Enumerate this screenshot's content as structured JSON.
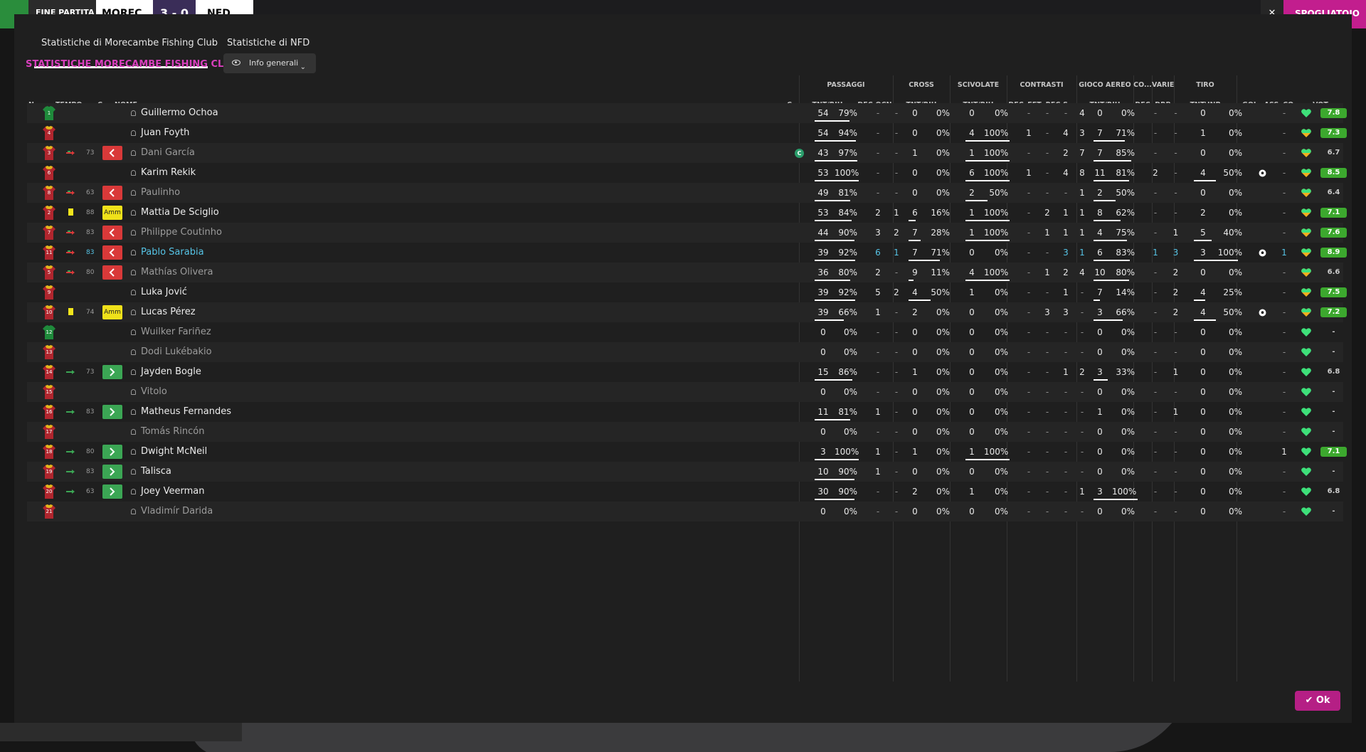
{
  "topbar": {
    "end_match": "FINE PARTITA",
    "home": "MOREC",
    "score": "3 - 0",
    "away": "NFD",
    "close": "✕",
    "subs": "SPOGLIATOIO"
  },
  "tabs": [
    {
      "label": "Statistiche di Morecambe Fishing Club",
      "active": true
    },
    {
      "label": "Statistiche di NFD",
      "active": false
    }
  ],
  "section_title": "STATISTICHE MORECAMBE FISHING CLUB",
  "view_dropdown": {
    "label": "Info generali"
  },
  "groups": {
    "passaggi": "PASSAGGI",
    "cross": "CROSS",
    "scivolate": "SCIVOLATE",
    "contrasti": "CONTRASTI",
    "gioco_aereo": "GIOCO AEREO",
    "co": "CO...",
    "varie": "VARIE",
    "tiro": "TIRO"
  },
  "columns": {
    "n": "N.",
    "tempo": "TEMPO",
    "c": "C",
    "nome": "NOME",
    "c2": "C",
    "pass_tr": "TNT/RIU",
    "dec": "DEC",
    "ocn": "OCN",
    "cross_tr": "TNT/RIU",
    "sciv_tr": "TNT/RIU",
    "c_dec": "DEC",
    "fft": "FFT",
    "rec": "REC",
    "s": "S...",
    "air_tr": "TNT/RIU",
    "co_dec": "DEC",
    "drb": "DRB",
    "tiro_tr": "TNT\\INP",
    "gol": "GOL",
    "ass": "ASS",
    "cond": "CO...",
    "vot": "VOT"
  },
  "players": [
    {
      "n": "1",
      "name": "Guillermo Ochoa",
      "gk": true,
      "min": "",
      "sub": "",
      "badge": "",
      "card": false,
      "captain": false,
      "dim": false,
      "hl": false,
      "pt": "54",
      "pp": "79%",
      "pf": 0.79,
      "dec": "-",
      "ocn": "-",
      "ct": "0",
      "cp": "0%",
      "cf": 0,
      "st": "0",
      "sp": "0%",
      "sf": 0,
      "kdec": "-",
      "fft": "-",
      "rec": "-",
      "s": "4",
      "at": "0",
      "ap": "0%",
      "af": 0,
      "cdec": "-",
      "drb": "-",
      "tt": "0",
      "tp": "0%",
      "tf": 0,
      "gol": "",
      "ass": "-",
      "heart": "green",
      "rating": "7.8",
      "rc": "#3ca82e"
    },
    {
      "n": "4",
      "name": "Juan Foyth",
      "gk": false,
      "min": "",
      "sub": "",
      "badge": "",
      "card": false,
      "captain": false,
      "dim": false,
      "hl": false,
      "pt": "54",
      "pp": "94%",
      "pf": 0.94,
      "dec": "-",
      "ocn": "-",
      "ct": "0",
      "cp": "0%",
      "cf": 0,
      "st": "4",
      "sp": "100%",
      "sf": 1,
      "kdec": "1",
      "fft": "-",
      "rec": "4",
      "s": "3",
      "at": "7",
      "ap": "71%",
      "af": 0.71,
      "cdec": "-",
      "drb": "-",
      "tt": "1",
      "tp": "0%",
      "tf": 0,
      "gol": "",
      "ass": "-",
      "heart": "half",
      "rating": "7.3",
      "rc": "#3ca82e"
    },
    {
      "n": "3",
      "name": "Dani García",
      "gk": false,
      "min": "73",
      "sub": "out",
      "badge": "out",
      "card": false,
      "captain": true,
      "dim": true,
      "hl": false,
      "pt": "43",
      "pp": "97%",
      "pf": 0.97,
      "dec": "-",
      "ocn": "-",
      "ct": "1",
      "cp": "0%",
      "cf": 0,
      "st": "1",
      "sp": "100%",
      "sf": 1,
      "kdec": "-",
      "fft": "-",
      "rec": "2",
      "s": "7",
      "at": "7",
      "ap": "85%",
      "af": 0.85,
      "cdec": "-",
      "drb": "-",
      "tt": "0",
      "tp": "0%",
      "tf": 0,
      "gol": "",
      "ass": "-",
      "heart": "half",
      "rating": "6.7",
      "rc": ""
    },
    {
      "n": "6",
      "name": "Karim Rekik",
      "gk": false,
      "min": "",
      "sub": "",
      "badge": "",
      "card": false,
      "captain": false,
      "dim": false,
      "hl": false,
      "pt": "53",
      "pp": "100%",
      "pf": 1,
      "dec": "-",
      "ocn": "-",
      "ct": "0",
      "cp": "0%",
      "cf": 0,
      "st": "6",
      "sp": "100%",
      "sf": 1,
      "kdec": "1",
      "fft": "-",
      "rec": "4",
      "s": "8",
      "at": "11",
      "ap": "81%",
      "af": 0.81,
      "cdec": "2",
      "drb": "-",
      "tt": "4",
      "tp": "50%",
      "tf": 0.5,
      "gol": "ball",
      "ass": "-",
      "heart": "half",
      "rating": "8.5",
      "rc": "#3ca82e"
    },
    {
      "n": "8",
      "name": "Paulinho",
      "gk": false,
      "min": "63",
      "sub": "out",
      "badge": "out",
      "card": false,
      "captain": false,
      "dim": true,
      "hl": false,
      "pt": "49",
      "pp": "81%",
      "pf": 0.81,
      "dec": "-",
      "ocn": "-",
      "ct": "0",
      "cp": "0%",
      "cf": 0,
      "st": "2",
      "sp": "50%",
      "sf": 0.5,
      "kdec": "-",
      "fft": "-",
      "rec": "-",
      "s": "1",
      "at": "2",
      "ap": "50%",
      "af": 0.5,
      "cdec": "-",
      "drb": "-",
      "tt": "0",
      "tp": "0%",
      "tf": 0,
      "gol": "",
      "ass": "-",
      "heart": "half",
      "rating": "6.4",
      "rc": ""
    },
    {
      "n": "2",
      "name": "Mattia De Sciglio",
      "gk": false,
      "min": "88",
      "sub": "",
      "badge": "amm",
      "card": true,
      "captain": false,
      "dim": false,
      "hl": false,
      "pt": "53",
      "pp": "84%",
      "pf": 0.84,
      "dec": "2",
      "ocn": "1",
      "ct": "6",
      "cp": "16%",
      "cf": 0.16,
      "st": "1",
      "sp": "100%",
      "sf": 1,
      "kdec": "-",
      "fft": "2",
      "rec": "1",
      "s": "1",
      "at": "8",
      "ap": "62%",
      "af": 0.62,
      "cdec": "-",
      "drb": "-",
      "tt": "2",
      "tp": "0%",
      "tf": 0,
      "gol": "",
      "ass": "-",
      "heart": "half",
      "rating": "7.1",
      "rc": "#3ca82e"
    },
    {
      "n": "7",
      "name": "Philippe Coutinho",
      "gk": false,
      "min": "83",
      "sub": "out",
      "badge": "out",
      "card": false,
      "captain": false,
      "dim": true,
      "hl": false,
      "pt": "44",
      "pp": "90%",
      "pf": 0.9,
      "dec": "3",
      "ocn": "2",
      "ct": "7",
      "cp": "28%",
      "cf": 0.28,
      "st": "1",
      "sp": "100%",
      "sf": 1,
      "kdec": "-",
      "fft": "1",
      "rec": "1",
      "s": "1",
      "at": "4",
      "ap": "75%",
      "af": 0.75,
      "cdec": "-",
      "drb": "1",
      "tt": "5",
      "tp": "40%",
      "tf": 0.4,
      "gol": "",
      "ass": "-",
      "heart": "half",
      "rating": "7.6",
      "rc": "#3ca82e"
    },
    {
      "n": "11",
      "name": "Pablo Sarabia",
      "gk": false,
      "min": "83",
      "sub": "out",
      "badge": "out",
      "card": false,
      "captain": false,
      "dim": false,
      "hl": true,
      "pt": "39",
      "pp": "92%",
      "pf": 0.92,
      "dec": "6",
      "ocn": "1",
      "ct": "7",
      "cp": "71%",
      "cf": 0.71,
      "st": "0",
      "sp": "0%",
      "sf": 0,
      "kdec": "-",
      "fft": "-",
      "rec": "3",
      "s": "1",
      "at": "6",
      "ap": "83%",
      "af": 0.83,
      "cdec": "1",
      "drb": "3",
      "tt": "3",
      "tp": "100%",
      "tf": 1,
      "gol": "ball",
      "ass": "1",
      "heart": "half",
      "rating": "8.9",
      "rc": "#3ca82e"
    },
    {
      "n": "5",
      "name": "Mathías Olivera",
      "gk": false,
      "min": "80",
      "sub": "out",
      "badge": "out",
      "card": false,
      "captain": false,
      "dim": true,
      "hl": false,
      "pt": "36",
      "pp": "80%",
      "pf": 0.8,
      "dec": "2",
      "ocn": "-",
      "ct": "9",
      "cp": "11%",
      "cf": 0.11,
      "st": "4",
      "sp": "100%",
      "sf": 1,
      "kdec": "-",
      "fft": "1",
      "rec": "2",
      "s": "4",
      "at": "10",
      "ap": "80%",
      "af": 0.8,
      "cdec": "-",
      "drb": "2",
      "tt": "0",
      "tp": "0%",
      "tf": 0,
      "gol": "",
      "ass": "-",
      "heart": "half",
      "rating": "6.6",
      "rc": ""
    },
    {
      "n": "9",
      "name": "Luka Jović",
      "gk": false,
      "min": "",
      "sub": "",
      "badge": "",
      "card": false,
      "captain": false,
      "dim": false,
      "hl": false,
      "pt": "39",
      "pp": "92%",
      "pf": 0.92,
      "dec": "5",
      "ocn": "2",
      "ct": "4",
      "cp": "50%",
      "cf": 0.5,
      "st": "1",
      "sp": "0%",
      "sf": 0,
      "kdec": "-",
      "fft": "-",
      "rec": "1",
      "s": "-",
      "at": "7",
      "ap": "14%",
      "af": 0.14,
      "cdec": "-",
      "drb": "2",
      "tt": "4",
      "tp": "25%",
      "tf": 0.25,
      "gol": "",
      "ass": "-",
      "heart": "half",
      "rating": "7.5",
      "rc": "#3ca82e"
    },
    {
      "n": "10",
      "name": "Lucas Pérez",
      "gk": false,
      "min": "74",
      "sub": "",
      "badge": "amm",
      "card": true,
      "captain": false,
      "dim": false,
      "hl": false,
      "pt": "39",
      "pp": "66%",
      "pf": 0.66,
      "dec": "1",
      "ocn": "-",
      "ct": "2",
      "cp": "0%",
      "cf": 0,
      "st": "0",
      "sp": "0%",
      "sf": 0,
      "kdec": "-",
      "fft": "3",
      "rec": "3",
      "s": "-",
      "at": "3",
      "ap": "66%",
      "af": 0.66,
      "cdec": "-",
      "drb": "2",
      "tt": "4",
      "tp": "50%",
      "tf": 0.5,
      "gol": "ball",
      "ass": "-",
      "heart": "half",
      "rating": "7.2",
      "rc": "#3ca82e"
    },
    {
      "n": "12",
      "name": "Wuilker Fariñez",
      "gk": true,
      "min": "",
      "sub": "",
      "badge": "",
      "card": false,
      "captain": false,
      "dim": true,
      "hl": false,
      "pt": "0",
      "pp": "0%",
      "pf": 0,
      "dec": "-",
      "ocn": "-",
      "ct": "0",
      "cp": "0%",
      "cf": 0,
      "st": "0",
      "sp": "0%",
      "sf": 0,
      "kdec": "-",
      "fft": "-",
      "rec": "-",
      "s": "-",
      "at": "0",
      "ap": "0%",
      "af": 0,
      "cdec": "-",
      "drb": "-",
      "tt": "0",
      "tp": "0%",
      "tf": 0,
      "gol": "",
      "ass": "-",
      "heart": "green",
      "rating": "-",
      "rc": ""
    },
    {
      "n": "13",
      "name": "Dodi Lukébakio",
      "gk": false,
      "min": "",
      "sub": "",
      "badge": "",
      "card": false,
      "captain": false,
      "dim": true,
      "hl": false,
      "pt": "0",
      "pp": "0%",
      "pf": 0,
      "dec": "-",
      "ocn": "-",
      "ct": "0",
      "cp": "0%",
      "cf": 0,
      "st": "0",
      "sp": "0%",
      "sf": 0,
      "kdec": "-",
      "fft": "-",
      "rec": "-",
      "s": "-",
      "at": "0",
      "ap": "0%",
      "af": 0,
      "cdec": "-",
      "drb": "-",
      "tt": "0",
      "tp": "0%",
      "tf": 0,
      "gol": "",
      "ass": "-",
      "heart": "green",
      "rating": "-",
      "rc": ""
    },
    {
      "n": "14",
      "name": "Jayden Bogle",
      "gk": false,
      "min": "73",
      "sub": "in",
      "badge": "in",
      "card": false,
      "captain": false,
      "dim": false,
      "hl": false,
      "pt": "15",
      "pp": "86%",
      "pf": 0.86,
      "dec": "-",
      "ocn": "-",
      "ct": "1",
      "cp": "0%",
      "cf": 0,
      "st": "0",
      "sp": "0%",
      "sf": 0,
      "kdec": "-",
      "fft": "-",
      "rec": "1",
      "s": "2",
      "at": "3",
      "ap": "33%",
      "af": 0.33,
      "cdec": "-",
      "drb": "1",
      "tt": "0",
      "tp": "0%",
      "tf": 0,
      "gol": "",
      "ass": "-",
      "heart": "green",
      "rating": "6.8",
      "rc": ""
    },
    {
      "n": "15",
      "name": "Vitolo",
      "gk": false,
      "min": "",
      "sub": "",
      "badge": "",
      "card": false,
      "captain": false,
      "dim": true,
      "hl": false,
      "pt": "0",
      "pp": "0%",
      "pf": 0,
      "dec": "-",
      "ocn": "-",
      "ct": "0",
      "cp": "0%",
      "cf": 0,
      "st": "0",
      "sp": "0%",
      "sf": 0,
      "kdec": "-",
      "fft": "-",
      "rec": "-",
      "s": "-",
      "at": "0",
      "ap": "0%",
      "af": 0,
      "cdec": "-",
      "drb": "-",
      "tt": "0",
      "tp": "0%",
      "tf": 0,
      "gol": "",
      "ass": "-",
      "heart": "green",
      "rating": "-",
      "rc": ""
    },
    {
      "n": "16",
      "name": "Matheus Fernandes",
      "gk": false,
      "min": "83",
      "sub": "in",
      "badge": "in",
      "card": false,
      "captain": false,
      "dim": false,
      "hl": false,
      "pt": "11",
      "pp": "81%",
      "pf": 0.81,
      "dec": "1",
      "ocn": "-",
      "ct": "0",
      "cp": "0%",
      "cf": 0,
      "st": "0",
      "sp": "0%",
      "sf": 0,
      "kdec": "-",
      "fft": "-",
      "rec": "-",
      "s": "-",
      "at": "1",
      "ap": "0%",
      "af": 0,
      "cdec": "-",
      "drb": "1",
      "tt": "0",
      "tp": "0%",
      "tf": 0,
      "gol": "",
      "ass": "-",
      "heart": "green",
      "rating": "-",
      "rc": ""
    },
    {
      "n": "17",
      "name": "Tomás Rincón",
      "gk": false,
      "min": "",
      "sub": "",
      "badge": "",
      "card": false,
      "captain": false,
      "dim": true,
      "hl": false,
      "pt": "0",
      "pp": "0%",
      "pf": 0,
      "dec": "-",
      "ocn": "-",
      "ct": "0",
      "cp": "0%",
      "cf": 0,
      "st": "0",
      "sp": "0%",
      "sf": 0,
      "kdec": "-",
      "fft": "-",
      "rec": "-",
      "s": "-",
      "at": "0",
      "ap": "0%",
      "af": 0,
      "cdec": "-",
      "drb": "-",
      "tt": "0",
      "tp": "0%",
      "tf": 0,
      "gol": "",
      "ass": "-",
      "heart": "green",
      "rating": "-",
      "rc": ""
    },
    {
      "n": "18",
      "name": "Dwight McNeil",
      "gk": false,
      "min": "80",
      "sub": "in",
      "badge": "in",
      "card": false,
      "captain": false,
      "dim": false,
      "hl": false,
      "pt": "3",
      "pp": "100%",
      "pf": 1,
      "dec": "1",
      "ocn": "-",
      "ct": "1",
      "cp": "0%",
      "cf": 0,
      "st": "1",
      "sp": "100%",
      "sf": 1,
      "kdec": "-",
      "fft": "-",
      "rec": "-",
      "s": "-",
      "at": "0",
      "ap": "0%",
      "af": 0,
      "cdec": "-",
      "drb": "-",
      "tt": "0",
      "tp": "0%",
      "tf": 0,
      "gol": "",
      "ass": "1",
      "heart": "green",
      "rating": "7.1",
      "rc": "#3ca82e"
    },
    {
      "n": "19",
      "name": "Talisca",
      "gk": false,
      "min": "83",
      "sub": "in",
      "badge": "in",
      "card": false,
      "captain": false,
      "dim": false,
      "hl": false,
      "pt": "10",
      "pp": "90%",
      "pf": 0.9,
      "dec": "1",
      "ocn": "-",
      "ct": "0",
      "cp": "0%",
      "cf": 0,
      "st": "0",
      "sp": "0%",
      "sf": 0,
      "kdec": "-",
      "fft": "-",
      "rec": "-",
      "s": "-",
      "at": "0",
      "ap": "0%",
      "af": 0,
      "cdec": "-",
      "drb": "-",
      "tt": "0",
      "tp": "0%",
      "tf": 0,
      "gol": "",
      "ass": "-",
      "heart": "green",
      "rating": "-",
      "rc": ""
    },
    {
      "n": "20",
      "name": "Joey Veerman",
      "gk": false,
      "min": "63",
      "sub": "in",
      "badge": "in",
      "card": false,
      "captain": false,
      "dim": false,
      "hl": false,
      "pt": "30",
      "pp": "90%",
      "pf": 0.9,
      "dec": "-",
      "ocn": "-",
      "ct": "2",
      "cp": "0%",
      "cf": 0,
      "st": "1",
      "sp": "0%",
      "sf": 0,
      "kdec": "-",
      "fft": "-",
      "rec": "-",
      "s": "1",
      "at": "3",
      "ap": "100%",
      "af": 1,
      "cdec": "-",
      "drb": "-",
      "tt": "0",
      "tp": "0%",
      "tf": 0,
      "gol": "",
      "ass": "-",
      "heart": "green",
      "rating": "6.8",
      "rc": ""
    },
    {
      "n": "21",
      "name": "Vladimír Darida",
      "gk": false,
      "min": "",
      "sub": "",
      "badge": "",
      "card": false,
      "captain": false,
      "dim": true,
      "hl": false,
      "pt": "0",
      "pp": "0%",
      "pf": 0,
      "dec": "-",
      "ocn": "-",
      "ct": "0",
      "cp": "0%",
      "cf": 0,
      "st": "0",
      "sp": "0%",
      "sf": 0,
      "kdec": "-",
      "fft": "-",
      "rec": "-",
      "s": "-",
      "at": "0",
      "ap": "0%",
      "af": 0,
      "cdec": "-",
      "drb": "-",
      "tt": "0",
      "tp": "0%",
      "tf": 0,
      "gol": "",
      "ass": "-",
      "heart": "green",
      "rating": "-",
      "rc": ""
    }
  ],
  "badges": {
    "amm": "Amm"
  },
  "captain_letter": "C",
  "ok_button": "Ok",
  "colors": {
    "accent": "#c21e8e",
    "title": "#d83fbd",
    "rating_green": "#3ca82e",
    "sub_in": "#3ba654",
    "sub_out": "#d93939",
    "yellow": "#f2e51c"
  }
}
